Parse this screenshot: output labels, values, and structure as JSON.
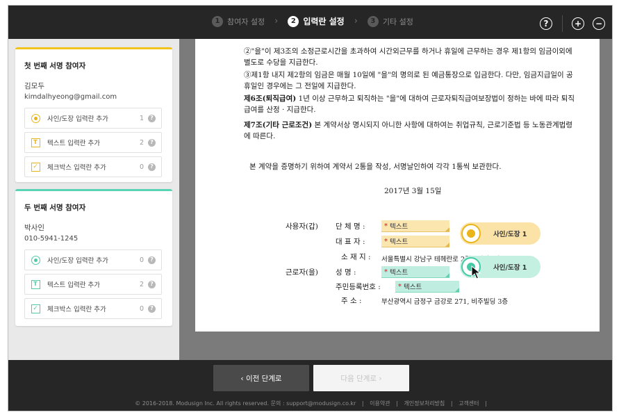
{
  "steps": [
    {
      "num": "1",
      "label": "참여자 설정"
    },
    {
      "num": "2",
      "label": "입력란 설정"
    },
    {
      "num": "3",
      "label": "기타 설정"
    }
  ],
  "step_separator": "›",
  "top_icons": {
    "help": "?",
    "zoom_in": "+",
    "zoom_out": "−"
  },
  "participants": [
    {
      "title": "첫 번째 서명 참여자",
      "name": "김모두",
      "contact": "kimdalhyeong@gmail.com",
      "accent": "#f2c21d",
      "fields": [
        {
          "label": "사인/도장 입력란 추가",
          "count": "1"
        },
        {
          "label": "텍스트 입력란 추가",
          "count": "2"
        },
        {
          "label": "체크박스 입력란 추가",
          "count": "0"
        }
      ]
    },
    {
      "title": "두 번째 서명 참여자",
      "name": "박사인",
      "contact": "010-5941-1245",
      "accent": "#58d3b3",
      "fields": [
        {
          "label": "사인/도장 입력란 추가",
          "count": "0"
        },
        {
          "label": "텍스트 입력란 추가",
          "count": "2"
        },
        {
          "label": "체크박스 입력란 추가",
          "count": "0"
        }
      ]
    }
  ],
  "document": {
    "p1": "②\"을\"이 제3조의 소정근로시간을 초과하여 시간외근무를 하거나 휴일에 근무하는 경우 제1항의 임금이외에 별도로 수당을 지급한다.",
    "p2": "③제1항 내지 제2항의 임금은 매월 10일에 \"을\"의 명의로 된 예금통장으로 입금한다. 다만, 임금지급일이 공휴일인 경우에는 그 전일에 지급한다.",
    "p3_head": "제6조(퇴직급여)",
    "p3_body": " 1년 이상 근무하고 퇴직하는 \"을\"에 대하여 근로자퇴직급여보장법이 정하는 바에 따라 퇴직급여를 산정 · 지급한다.",
    "p4_head": "제7조(기타 근로조건)",
    "p4_body": " 본 계약서상 명시되지 아니한 사항에 대하여는 취업규칙, 근로기준법 등 노동관계법령에 따른다.",
    "p5": "본 계약을 증명하기 위하여 계약서 2통을 작성, 서명날인하여 각각 1통씩 보관한다.",
    "date": "2017년  3월 15일",
    "employer_label": "사용자(갑)",
    "employee_label": "근로자(을)",
    "company_label": "단 체 명 :",
    "rep_label": "대 표 자 :",
    "addr_label": "소 재 지 :",
    "addr_value": "서울특별시 강남구 테헤란로 2길 8빌딩 4층",
    "emp_name_label": "성      명 :",
    "emp_id_label": "주민등록번호 :",
    "emp_addr_label": "주      소 :",
    "emp_addr_value": "부산광역시 금정구 금강로 271, 비주빌딩 3층"
  },
  "overlay_text": "텍스트",
  "required_mark": "*",
  "stamp_label": "사인/도장 1",
  "buttons": {
    "prev": "‹ 이전 단계로",
    "next": "다음 단계로 ›"
  },
  "footer": [
    "© 2016-2018. Modusign Inc. All rights reserved.  문의 : support@modusign.co.kr",
    "이용약관",
    "개인정보처리방침",
    "고객센터"
  ],
  "footer_sep": "|",
  "colors": {
    "yellow_accent": "#f2c21d",
    "green_accent": "#58d3b3",
    "topbar": "#262626"
  }
}
